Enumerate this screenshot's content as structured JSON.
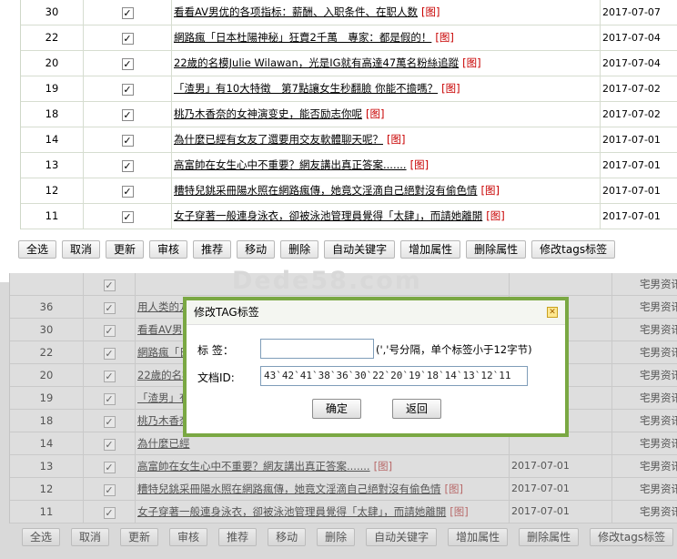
{
  "top_rows": [
    {
      "id": "30",
      "title": "看看AV男优的各项指标：薪酬、入职条件、在职人数",
      "img": "图",
      "date": "2017-07-07"
    },
    {
      "id": "22",
      "title": "網路瘋「日本杜陽神秘」狂賣2千萬　專家：都是假的！",
      "img": "图",
      "date": "2017-07-04"
    },
    {
      "id": "20",
      "title": "22歲的名模Julie Wilawan，光是IG就有高達47萬名粉絲追蹤",
      "img": "图",
      "date": "2017-07-04"
    },
    {
      "id": "19",
      "title": "「渣男」有10大特徵　第7點讓女生秒翻臉 你能不擔嗎？",
      "img": "图",
      "date": "2017-07-02"
    },
    {
      "id": "18",
      "title": "桃乃木香奈的女神演变史，能否励志你呢",
      "img": "图",
      "date": "2017-07-02"
    },
    {
      "id": "14",
      "title": "為什麼已經有女友了還要用交友軟體聊天呢？",
      "img": "图",
      "date": "2017-07-01"
    },
    {
      "id": "13",
      "title": "高富帥在女生心中不重要？網友講出真正答案.......",
      "img": "图",
      "date": "2017-07-01"
    },
    {
      "id": "12",
      "title": "糟特兒銚采冊陽水照在網路瘋傳，她竟文淫滴自己絕對沒有偷色情",
      "img": "图",
      "date": "2017-07-01"
    },
    {
      "id": "11",
      "title": "女子穿著一般連身泳衣，卻被泳池管理員覺得「太肆」，而請她離開",
      "img": "图",
      "date": "2017-07-01"
    }
  ],
  "toolbar": [
    "全选",
    "取消",
    "更新",
    "审核",
    "推荐",
    "移动",
    "删除",
    "自动关键字",
    "增加属性",
    "删除属性",
    "修改tags标签"
  ],
  "watermark": "Dede58.com",
  "bottom_rows": [
    {
      "id": "",
      "title": "",
      "img": "",
      "date": "",
      "cat": "宅男资讯"
    },
    {
      "id": "36",
      "title": "用人类的方",
      "img": "",
      "date": "",
      "cat": "宅男资讯"
    },
    {
      "id": "30",
      "title": "看看AV男",
      "img": "",
      "date": "",
      "cat": "宅男资讯"
    },
    {
      "id": "22",
      "title": "網路瘋「日",
      "img": "",
      "date": "",
      "cat": "宅男资讯"
    },
    {
      "id": "20",
      "title": "22歲的名模",
      "img": "",
      "date": "",
      "cat": "宅男资讯"
    },
    {
      "id": "19",
      "title": "「渣男」有",
      "img": "",
      "date": "",
      "cat": "宅男资讯"
    },
    {
      "id": "18",
      "title": "桃乃木香奈",
      "img": "",
      "date": "",
      "cat": "宅男资讯"
    },
    {
      "id": "14",
      "title": "為什麼已經",
      "img": "",
      "date": "",
      "cat": "宅男资讯"
    },
    {
      "id": "13",
      "title": "高富帥在女生心中不重要？網友講出真正答案.......",
      "img": "图",
      "date": "2017-07-01",
      "cat": "宅男资讯"
    },
    {
      "id": "12",
      "title": "糟特兒銚采冊陽水照在網路瘋傳，她竟文淫滴自己絕對沒有偷色情",
      "img": "图",
      "date": "2017-07-01",
      "cat": "宅男资讯"
    },
    {
      "id": "11",
      "title": "女子穿著一般連身泳衣，卻被泳池管理員覺得「太肆」，而請她離開",
      "img": "图",
      "date": "2017-07-01",
      "cat": "宅男资讯"
    }
  ],
  "modal": {
    "title": "修改TAG标签",
    "tags_label": "标  签：",
    "tags_value": "",
    "tags_hint": "(','号分隔，单个标签小于12字节)",
    "docid_label": "文档ID:",
    "docid_value": "43`42`41`38`36`30`22`20`19`18`14`13`12`11",
    "ok": "确定",
    "back": "返回"
  }
}
